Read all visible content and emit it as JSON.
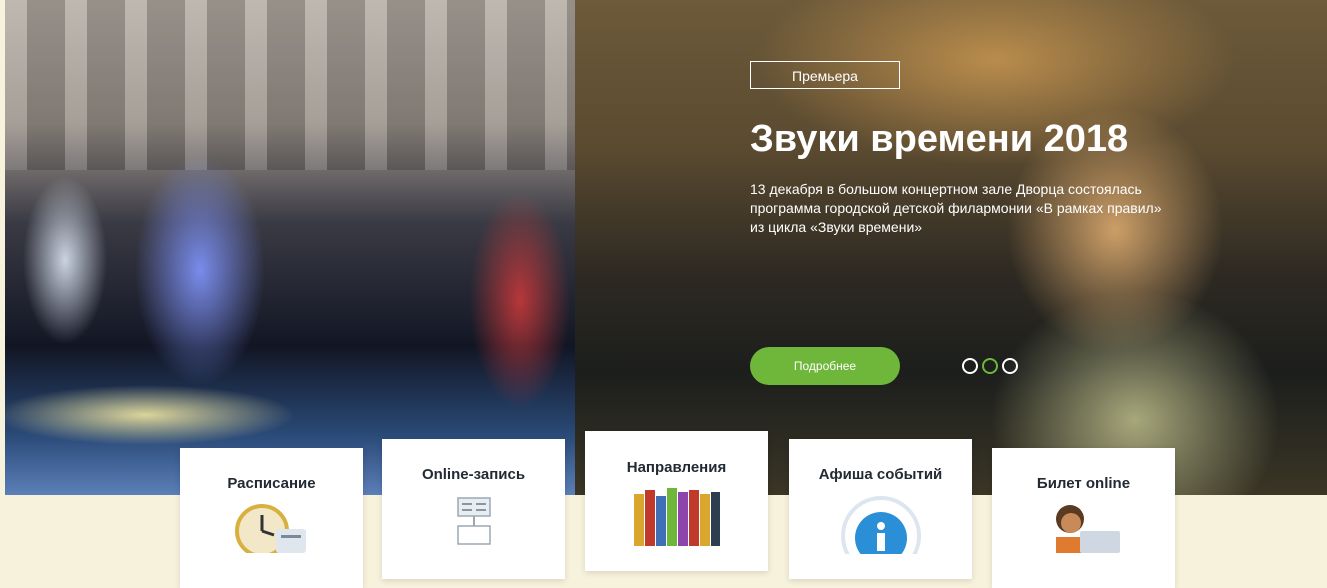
{
  "hero": {
    "badge": "Премьера",
    "title": "Звуки времени 2018",
    "description": "13 декабря в большом концертном зале Дворца состоялась программа городской детской филармонии «В рамках правил» из цикла «Звуки времени»",
    "more_button": "Подробнее",
    "slides_count": 3,
    "active_slide": 2,
    "accent_color": "#6fb73b"
  },
  "cards": [
    {
      "label": "Расписание",
      "icon": "clock-icon"
    },
    {
      "label": "Online-запись",
      "icon": "online-form-icon"
    },
    {
      "label": "Направления",
      "icon": "books-icon"
    },
    {
      "label": "Афиша событий",
      "icon": "info-icon"
    },
    {
      "label": "Билет online",
      "icon": "ticket-person-icon"
    }
  ]
}
